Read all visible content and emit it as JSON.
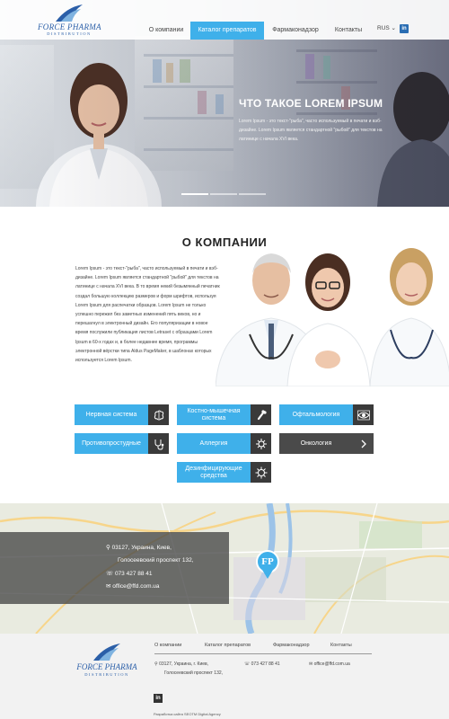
{
  "header": {
    "logo_brand": "FORCE PHARMA",
    "logo_sub": "DISTRIBUTION",
    "nav": [
      {
        "label": "О компании"
      },
      {
        "label": "Каталог препаратов"
      },
      {
        "label": "Фармаконадзор"
      },
      {
        "label": "Контакты"
      }
    ],
    "lang": "RUS ⌄",
    "linkedin": "in"
  },
  "hero": {
    "title": "ЧТО ТАКОЕ LOREM IPSUM",
    "text": "Lorem Ipsum - это текст-\"рыба\", часто используемый в печати и вэб-дизайне. Lorem Ipsum является стандартной \"рыбой\" для текстов на латинице с начала XVI века."
  },
  "about": {
    "title": "О КОМПАНИИ",
    "text": "Lorem Ipsum - это текст-\"рыба\", часто используемый в печати и вэб-дизайне. Lorem Ipsum является стандартной \"рыбой\" для текстов на латинице с начала XVI века. В то время некий безымянный печатник создал большую коллекцию размеров и форм шрифтов, используя Lorem Ipsum для распечатки образцов. Lorem Ipsum не только успешно пережил без заметных изменений пять веков, но и перешагнул в электронный дизайн. Его популяризации в новое время послужили публикация листов Letraset с образцами Lorem Ipsum в 60-х годах и, в более недавнее время, программы электронной вёрстки типа Aldus PageMaker, в шаблонах которых используется Lorem Ipsum."
  },
  "categories": [
    {
      "label": "Нервная система",
      "icon": "brain-icon"
    },
    {
      "label": "Костно-мышечная система",
      "icon": "bone-icon"
    },
    {
      "label": "Офтальмология",
      "icon": "eye-icon"
    },
    {
      "label": "Противопростудные",
      "icon": "stethoscope-icon"
    },
    {
      "label": "Аллергия",
      "icon": "virus-icon"
    },
    {
      "label": "Онкология",
      "icon": "chevron-right-icon"
    },
    {
      "label": "Дезинфицирующие средства",
      "icon": "germ-icon"
    }
  ],
  "contacts": {
    "address_line1": "03127, Украина, Киев,",
    "address_line2": "Голосеевский проспект 132,",
    "phone": "073 427 88 41",
    "email": "office@ffd.com.ua"
  },
  "map": {
    "pin_label": "FP"
  },
  "footer": {
    "nav": [
      "О компании",
      "Каталог препаратов",
      "Фармаконадзор",
      "Контакты"
    ],
    "address_line1": "03127, Украина, г. Киев,",
    "address_line2": "Голосеевский проспект 132,",
    "phone": "073 427 88 41",
    "email": "office@ffd.com.ua",
    "linkedin": "in",
    "copyright": "Разработка сайта SEOTM Digital Agency"
  },
  "colors": {
    "accent": "#3fb0ea",
    "dark": "#4a4a4a",
    "brand": "#2b5fa8"
  }
}
